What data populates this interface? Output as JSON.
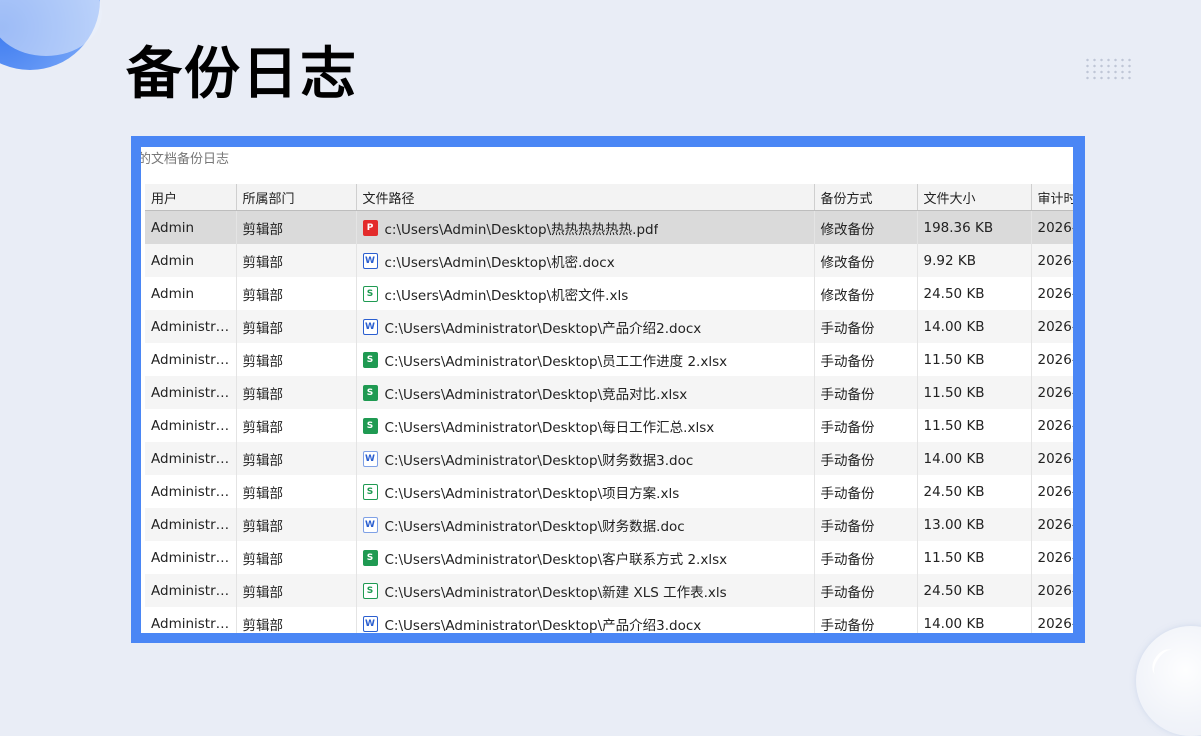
{
  "page": {
    "title": "备份日志"
  },
  "window": {
    "title": "的文档备份日志"
  },
  "table": {
    "columns": [
      "用户",
      "所属部门",
      "文件路径",
      "备份方式",
      "文件大小",
      "审计时"
    ],
    "rows": [
      {
        "user": "Admin",
        "dept": "剪辑部",
        "icon": "pdf",
        "path": "c:\\Users\\Admin\\Desktop\\热热热热热热.pdf",
        "mode": "修改备份",
        "size": "198.36 KB",
        "time": "2026-"
      },
      {
        "user": "Admin",
        "dept": "剪辑部",
        "icon": "docx",
        "path": "c:\\Users\\Admin\\Desktop\\机密.docx",
        "mode": "修改备份",
        "size": "9.92 KB",
        "time": "2026-"
      },
      {
        "user": "Admin",
        "dept": "剪辑部",
        "icon": "xls",
        "path": "c:\\Users\\Admin\\Desktop\\机密文件.xls",
        "mode": "修改备份",
        "size": "24.50 KB",
        "time": "2026-"
      },
      {
        "user": "Administra...",
        "dept": "剪辑部",
        "icon": "docx",
        "path": "C:\\Users\\Administrator\\Desktop\\产品介绍2.docx",
        "mode": "手动备份",
        "size": "14.00 KB",
        "time": "2026-"
      },
      {
        "user": "Administra...",
        "dept": "剪辑部",
        "icon": "xlsx",
        "path": "C:\\Users\\Administrator\\Desktop\\员工工作进度 2.xlsx",
        "mode": "手动备份",
        "size": "11.50 KB",
        "time": "2026-"
      },
      {
        "user": "Administra...",
        "dept": "剪辑部",
        "icon": "xlsx",
        "path": "C:\\Users\\Administrator\\Desktop\\竞品对比.xlsx",
        "mode": "手动备份",
        "size": "11.50 KB",
        "time": "2026-"
      },
      {
        "user": "Administra...",
        "dept": "剪辑部",
        "icon": "xlsx",
        "path": "C:\\Users\\Administrator\\Desktop\\每日工作汇总.xlsx",
        "mode": "手动备份",
        "size": "11.50 KB",
        "time": "2026-"
      },
      {
        "user": "Administra...",
        "dept": "剪辑部",
        "icon": "doc",
        "path": "C:\\Users\\Administrator\\Desktop\\财务数据3.doc",
        "mode": "手动备份",
        "size": "14.00 KB",
        "time": "2026-"
      },
      {
        "user": "Administra...",
        "dept": "剪辑部",
        "icon": "xls",
        "path": "C:\\Users\\Administrator\\Desktop\\项目方案.xls",
        "mode": "手动备份",
        "size": "24.50 KB",
        "time": "2026-"
      },
      {
        "user": "Administra...",
        "dept": "剪辑部",
        "icon": "doc",
        "path": "C:\\Users\\Administrator\\Desktop\\财务数据.doc",
        "mode": "手动备份",
        "size": "13.00 KB",
        "time": "2026-"
      },
      {
        "user": "Administra...",
        "dept": "剪辑部",
        "icon": "xlsx",
        "path": "C:\\Users\\Administrator\\Desktop\\客户联系方式 2.xlsx",
        "mode": "手动备份",
        "size": "11.50 KB",
        "time": "2026-"
      },
      {
        "user": "Administra...",
        "dept": "剪辑部",
        "icon": "xls",
        "path": "C:\\Users\\Administrator\\Desktop\\新建 XLS 工作表.xls",
        "mode": "手动备份",
        "size": "24.50 KB",
        "time": "2026-"
      },
      {
        "user": "Administra...",
        "dept": "剪辑部",
        "icon": "docx",
        "path": "C:\\Users\\Administrator\\Desktop\\产品介绍3.docx",
        "mode": "手动备份",
        "size": "14.00 KB",
        "time": "2026-"
      }
    ],
    "selected_row": 0
  },
  "colors": {
    "frame": "#4a86f5",
    "background": "#e9edf6",
    "selected_row": "#dadada"
  }
}
